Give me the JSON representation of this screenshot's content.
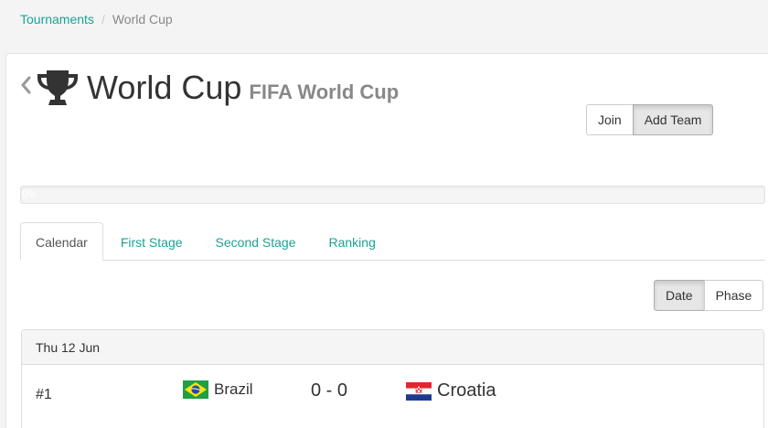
{
  "breadcrumb": {
    "items": [
      {
        "label": "Tournaments"
      },
      {
        "label": "World Cup"
      }
    ]
  },
  "header": {
    "title": "World Cup",
    "subtitle": "FIFA World Cup",
    "back_icon": "chevron-left-icon",
    "trophy_icon": "trophy-icon"
  },
  "actions": {
    "join_label": "Join",
    "add_team_label": "Add Team"
  },
  "progress": {
    "label": "0%",
    "value_percent": 0
  },
  "tabs": [
    {
      "label": "Calendar",
      "active": true
    },
    {
      "label": "First Stage",
      "active": false
    },
    {
      "label": "Second Stage",
      "active": false
    },
    {
      "label": "Ranking",
      "active": false
    }
  ],
  "view_toggle": {
    "date_label": "Date",
    "phase_label": "Phase",
    "selected": "Date"
  },
  "calendar": {
    "days": [
      {
        "date": "Thu 12 Jun",
        "matches": [
          {
            "number": "#1",
            "home_team": "Brazil",
            "home_flag": "brazil-flag-icon",
            "score": "0 - 0",
            "away_team": "Croatia",
            "away_flag": "croatia-flag-icon"
          }
        ]
      }
    ]
  },
  "colors": {
    "accent": "#1aa394",
    "page_bg": "#f4f4f4"
  }
}
